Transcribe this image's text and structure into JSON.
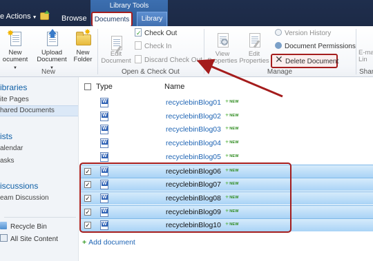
{
  "topbar": {
    "site_actions": "e Actions",
    "browse": "Browse",
    "tools_group": "Library Tools",
    "tab_documents": "Documents",
    "tab_library": "Library"
  },
  "ribbon": {
    "new_group": {
      "label": "New",
      "new_document_line1": "New",
      "new_document_line2": "ocument",
      "upload_line1": "Upload",
      "upload_line2": "Document",
      "new_folder_line1": "New",
      "new_folder_line2": "Folder"
    },
    "open_group": {
      "label": "Open & Check Out",
      "edit_line1": "Edit",
      "edit_line2": "Document",
      "check_out": "Check Out",
      "check_in": "Check In",
      "discard_check_out": "Discard Check Out"
    },
    "manage_group": {
      "label": "Manage",
      "view_line1": "View",
      "view_line2": "Properties",
      "edit_line1": "Edit",
      "edit_line2": "Properties",
      "version_history": "Version History",
      "document_permissions": "Document Permissions",
      "delete_document": "Delete Document"
    },
    "share_group": {
      "label": "Shar",
      "email_line1": "E-ma",
      "email_line2": "Lin"
    }
  },
  "leftnav": {
    "libraries": "ibraries",
    "site_pages": "ite Pages",
    "shared_documents": "hared Documents",
    "lists": "ists",
    "calendar": "alendar",
    "tasks": "asks",
    "discussions": "iscussions",
    "team_discussion": "eam Discussion",
    "recycle_bin": "Recycle Bin",
    "all_site_content": "All Site Content"
  },
  "list": {
    "col_type": "Type",
    "col_name": "Name",
    "new_badge": "NEW",
    "rows": [
      {
        "name": "recyclebinBlog01",
        "selected": false
      },
      {
        "name": "recyclebinBlog02",
        "selected": false
      },
      {
        "name": "recyclebinBlog03",
        "selected": false
      },
      {
        "name": "recyclebinBlog04",
        "selected": false
      },
      {
        "name": "recyclebinBlog05",
        "selected": false
      },
      {
        "name": "recyclebinBlog06",
        "selected": true
      },
      {
        "name": "recyclebinBlog07",
        "selected": true
      },
      {
        "name": "recyclebinBlog08",
        "selected": true
      },
      {
        "name": "recyclebinBlog09",
        "selected": true
      },
      {
        "name": "recyclebinBlog10",
        "selected": true
      }
    ],
    "add_document": "Add document"
  },
  "colors": {
    "highlight_red": "#a41c1c",
    "link_blue": "#1e64b4",
    "selected_row": "#a9d3f6"
  }
}
